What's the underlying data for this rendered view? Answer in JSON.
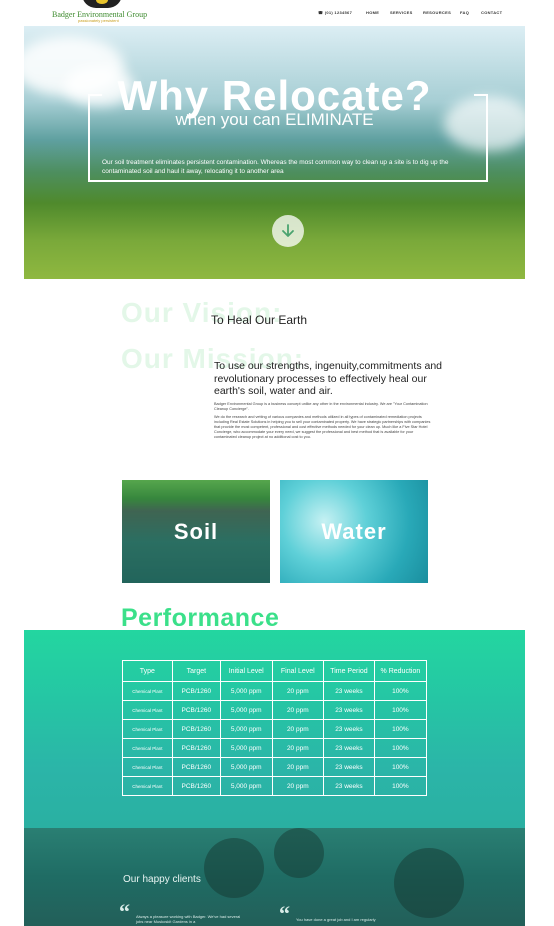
{
  "header": {
    "logo_name": "Badger Environmental Group",
    "logo_tagline": "passionately persistent",
    "nav": [
      {
        "label": "☎ (01) 1234567"
      },
      {
        "label": "HOME"
      },
      {
        "label": "SERVICES"
      },
      {
        "label": "RESOURCES"
      },
      {
        "label": "FAQ"
      },
      {
        "label": "CONTACT"
      }
    ]
  },
  "hero": {
    "title": "Why Relocate?",
    "subtitle": "when you can ELIMINATE",
    "body": "Our soil treatment eliminates persistent contamination. Whereas the most common way to clean up a site is to dig up the contaminated soil and haul it away, relocating it to another area",
    "scroll_icon": "arrow-down-icon"
  },
  "vision": {
    "heading": "Our Vision:",
    "text": "To Heal Our Earth"
  },
  "mission": {
    "heading": "Our Mission:",
    "text": "To use our strengths, ingenuity,commitments and revolutionary processes to effectively heal our earth's soil, water and air.",
    "small_1": "Badger Environmental Group is a business concept unlike any other in the environmental industry. We are \"Your Contamination Cleanup Concierge\".",
    "small_2": "We do the research and vetting of various companies and methods utilized in all types of contaminated remediation projects including Real Estate Solutions in helping you to sell your contaminated property. We have strategic partnerships with companies that provide the most competent, professional and cost effective methods needed for your clean up. Much like a Five Star Hotel Concierge, who accommodate your every need, we suggest the professional and best method that is available for your contaminated cleanup project at no additional cost to you."
  },
  "tiles": [
    {
      "label": "Soil"
    },
    {
      "label": "Water"
    }
  ],
  "performance": {
    "title": "Performance",
    "columns": [
      "Type",
      "Target",
      "Initial Level",
      "Final Level",
      "Time Period",
      "% Reduction"
    ],
    "rows": [
      [
        "Chemical Plant",
        "PCB/1260",
        "5,000 ppm",
        "20 ppm",
        "23 weeks",
        "100%"
      ],
      [
        "Chemical Plant",
        "PCB/1260",
        "5,000 ppm",
        "20 ppm",
        "23 weeks",
        "100%"
      ],
      [
        "Chemical Plant",
        "PCB/1260",
        "5,000 ppm",
        "20 ppm",
        "23 weeks",
        "100%"
      ],
      [
        "Chemical Plant",
        "PCB/1260",
        "5,000 ppm",
        "20 ppm",
        "23 weeks",
        "100%"
      ],
      [
        "Chemical Plant",
        "PCB/1260",
        "5,000 ppm",
        "20 ppm",
        "23 weeks",
        "100%"
      ],
      [
        "Chemical Plant",
        "PCB/1260",
        "5,000 ppm",
        "20 ppm",
        "23 weeks",
        "100%"
      ]
    ]
  },
  "clients": {
    "title": "Our happy clients",
    "quotes": [
      {
        "mark": "“",
        "text": "Always a pleasure working with Badger. We've had several jobs near Muskoskit Gardens in a"
      },
      {
        "mark": "“",
        "text": "You have done a great job and I am regularly"
      }
    ]
  },
  "colors": {
    "accent_green": "#3be08a",
    "band_teal": "#25c6a4",
    "clients_teal": "#1f6c64",
    "logo_green": "#3e8b2f"
  }
}
